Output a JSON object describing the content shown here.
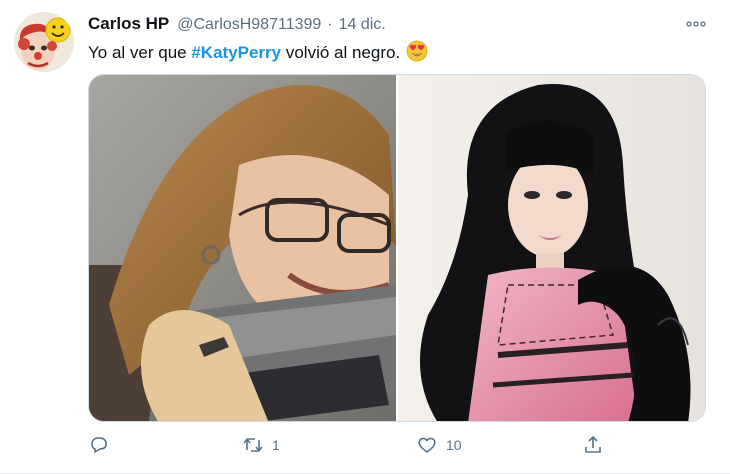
{
  "tweet": {
    "author": {
      "display_name": "Carlos HP",
      "handle": "@CarlosH98711399",
      "avatar_icon": "clown-smiley-avatar"
    },
    "separator": "·",
    "date": "14 dic.",
    "text_before": "Yo al ver que ",
    "hashtag": "#KatyPerry",
    "text_after": " volvió al negro.",
    "emoji": "heart-eyes-emoji",
    "media": [
      {
        "subject": "person-biting-laptop-photo"
      },
      {
        "subject": "katy-perry-black-hair-photo"
      }
    ],
    "actions": {
      "reply_count": "",
      "retweet_count": "1",
      "like_count": "10"
    }
  },
  "colors": {
    "link": "#1b95e0",
    "secondary_text": "#5b7083",
    "border": "#cfd9de"
  }
}
